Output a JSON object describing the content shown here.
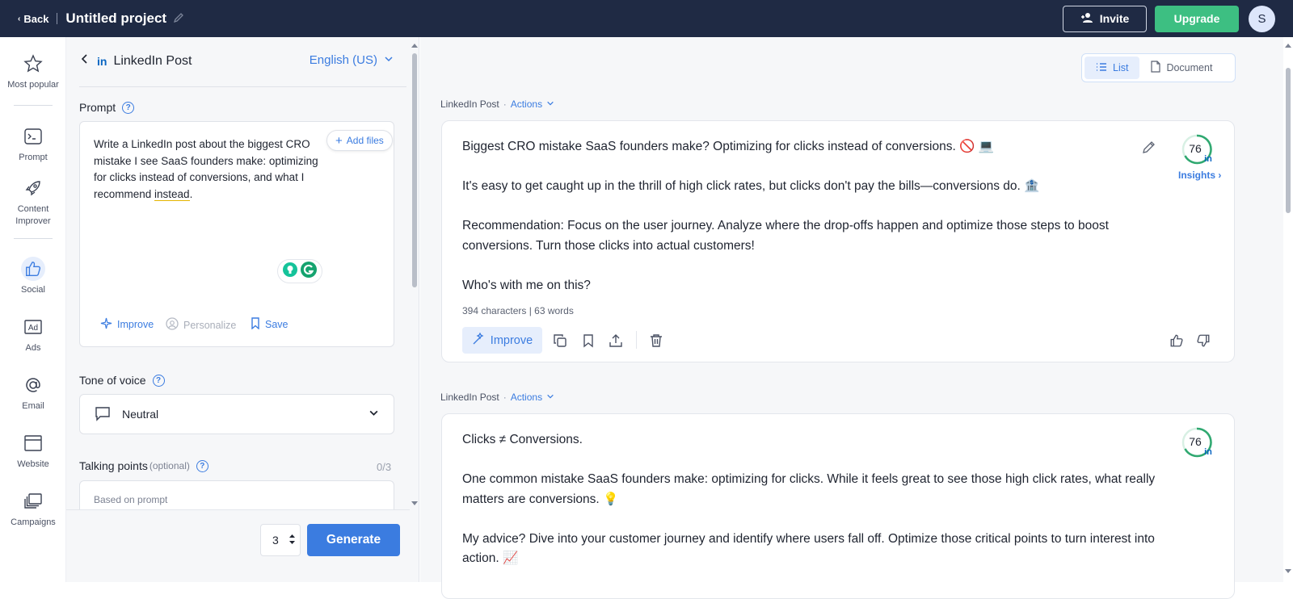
{
  "topbar": {
    "back": "Back",
    "project_title": "Untitled project",
    "invite": "Invite",
    "upgrade": "Upgrade",
    "avatar_initial": "S"
  },
  "rail": [
    {
      "label": "Most popular",
      "icon": "star-icon"
    },
    {
      "label": "Prompt",
      "icon": "terminal-icon"
    },
    {
      "label": "Content Improver",
      "icon": "rocket-icon"
    },
    {
      "label": "Social",
      "icon": "thumbs-up-icon"
    },
    {
      "label": "Ads",
      "icon": "ad-icon"
    },
    {
      "label": "Email",
      "icon": "at-icon"
    },
    {
      "label": "Website",
      "icon": "browser-icon"
    },
    {
      "label": "Campaigns",
      "icon": "stack-icon"
    }
  ],
  "left": {
    "tool_title": "LinkedIn Post",
    "language": "English (US)",
    "prompt_label": "Prompt",
    "prompt_text_a": "Write a LinkedIn post about the biggest CRO mistake I see SaaS founders make: optimizing for clicks instead of conversions, and what I recommend ",
    "prompt_text_b": "instead",
    "prompt_text_c": ".",
    "add_files": "Add files",
    "improve": "Improve",
    "personalize": "Personalize",
    "save": "Save",
    "tone_label": "Tone of voice",
    "tone_value": "Neutral",
    "talking_label": "Talking points",
    "talking_optional": "(optional)",
    "talking_count": "0/3",
    "talking_placeholder": "Based on prompt",
    "variant_count": "3",
    "generate": "Generate"
  },
  "right": {
    "view_list": "List",
    "view_document": "Document",
    "results": [
      {
        "section": "LinkedIn Post",
        "actions": "Actions",
        "paragraphs": [
          "Biggest CRO mistake SaaS founders make? Optimizing for clicks instead of conversions. 🚫 💻",
          "It's easy to get caught up in the thrill of high click rates, but clicks don't pay the bills—conversions do. 🏦",
          "Recommendation: Focus on the user journey. Analyze where the drop-offs happen and optimize those steps to boost conversions. Turn those clicks into actual customers!",
          "Who's with me on this?"
        ],
        "score": "76",
        "insights": "Insights ›",
        "meta": "394 characters | 63 words",
        "improve": "Improve"
      },
      {
        "section": "LinkedIn Post",
        "actions": "Actions",
        "paragraphs": [
          "Clicks ≠ Conversions.",
          "One common mistake SaaS founders make: optimizing for clicks. While it feels great to see those high click rates, what really matters are conversions. 💡",
          "My advice? Dive into your customer journey and identify where users fall off. Optimize those critical points to turn interest into action. 📈"
        ],
        "score": "76"
      }
    ]
  },
  "colors": {
    "topbar": "#1f2a44",
    "accent": "#3b7ce0",
    "upgrade": "#3dbf82",
    "score_ring": "#2fa870",
    "linkedin": "#0a66c2"
  }
}
